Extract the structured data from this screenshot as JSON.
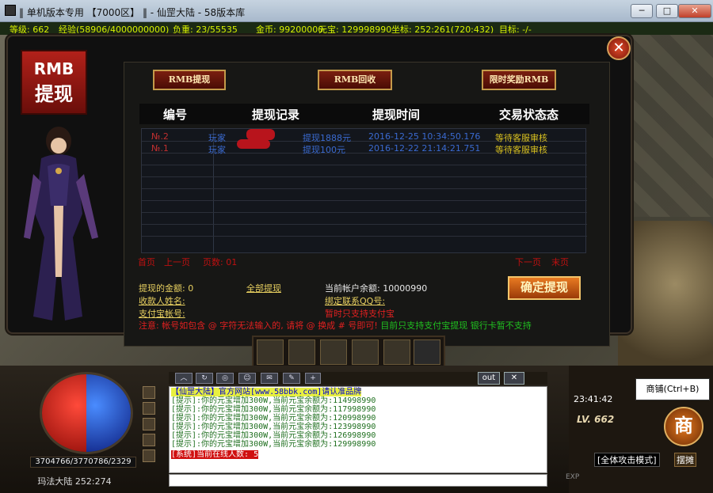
{
  "window": {
    "title": "‖ 单机版本专用 【7000区】 ‖ - 仙罡大陆 - 58版本库",
    "buttons": {
      "minimize": "─",
      "maximize": "□",
      "close": "✕"
    }
  },
  "status": {
    "level": "等级: 662",
    "exp": "经验(58906/4000000000)",
    "weight": "负重: 23/55535",
    "gold": "金币: 99200000",
    "yuanbao": "元宝: 129998990",
    "coords": "坐标: 252:261(720:432)",
    "target": "目标: -/-"
  },
  "badge": {
    "line1": "RMB",
    "line2": "提现"
  },
  "tabs": {
    "withdraw": "RMB提现",
    "recycle": "RMB回收",
    "reward": "限时奖励RMB"
  },
  "table": {
    "headers": [
      "编号",
      "提现记录",
      "提现时间",
      "交易状态态"
    ],
    "rows": [
      {
        "no": "№.2",
        "player": "玩家",
        "record": "提现1888元",
        "time": "2016-12-25 10:34:50.176",
        "status": "等待客服审核"
      },
      {
        "no": "№.1",
        "player": "玩家",
        "record": "提现100元",
        "time": "2016-12-22 21:14:21.751",
        "status": "等待客服审核"
      }
    ]
  },
  "pager": {
    "first": "首页",
    "prev": "上一页",
    "pages": "页数: 01",
    "next": "下一页",
    "last": "末页"
  },
  "form": {
    "amount_label": "提现的金额: 0",
    "withdraw_all": "全部提现",
    "balance": "当前帐户余额: 10000990",
    "name_label": "收款人姓名:",
    "qq_label": "绑定联系QQ号:",
    "alipay_label": "支付宝帐号:",
    "support_hint": "暂时只支持支付宝"
  },
  "confirm": "确定提现",
  "note": {
    "red": "注意: 帐号如包含 @ 字符无法输入的, 请将 @ 换成 # 号即可!",
    "green": "目前只支持支付宝提现 银行卡暂不支持"
  },
  "hud": {
    "hp_mp": "3704766/3770786/2329",
    "map": "玛法大陆",
    "map_coords": "252:274",
    "time": "23:41:42",
    "level": "LV. 662",
    "mode": "[全体攻击模式]",
    "stall": "摆摊",
    "shop_glyph": "商",
    "tooltip": "商铺(Ctrl+B)",
    "out_btn": "out",
    "x_btn": "✕",
    "exp_label": "EXP"
  },
  "chat": {
    "lines": [
      {
        "text": "【仙罡大陆】官方网站[www.58bbk.com]请认准品牌",
        "kind": "system"
      },
      {
        "text": "[提示]:你的元宝增加300W,当前元宝余额为:114998990",
        "kind": "tip"
      },
      {
        "text": "[提示]:你的元宝增加300W,当前元宝余额为:117998990",
        "kind": "tip"
      },
      {
        "text": "[提示]:你的元宝增加300W,当前元宝余额为:120998990",
        "kind": "tip"
      },
      {
        "text": "[提示]:你的元宝增加300W,当前元宝余额为:123998990",
        "kind": "tip"
      },
      {
        "text": "[提示]:你的元宝增加300W,当前元宝余额为:126998990",
        "kind": "tip"
      },
      {
        "text": "[提示]:你的元宝增加300W,当前元宝余额为:129998990",
        "kind": "tip"
      },
      {
        "text": "[系统]当前在线人数: 5",
        "kind": "online"
      }
    ]
  },
  "colors": {
    "accent": "#c01010",
    "tip": "#207020",
    "system": "#0000d0",
    "status_text": "#d8f000"
  }
}
